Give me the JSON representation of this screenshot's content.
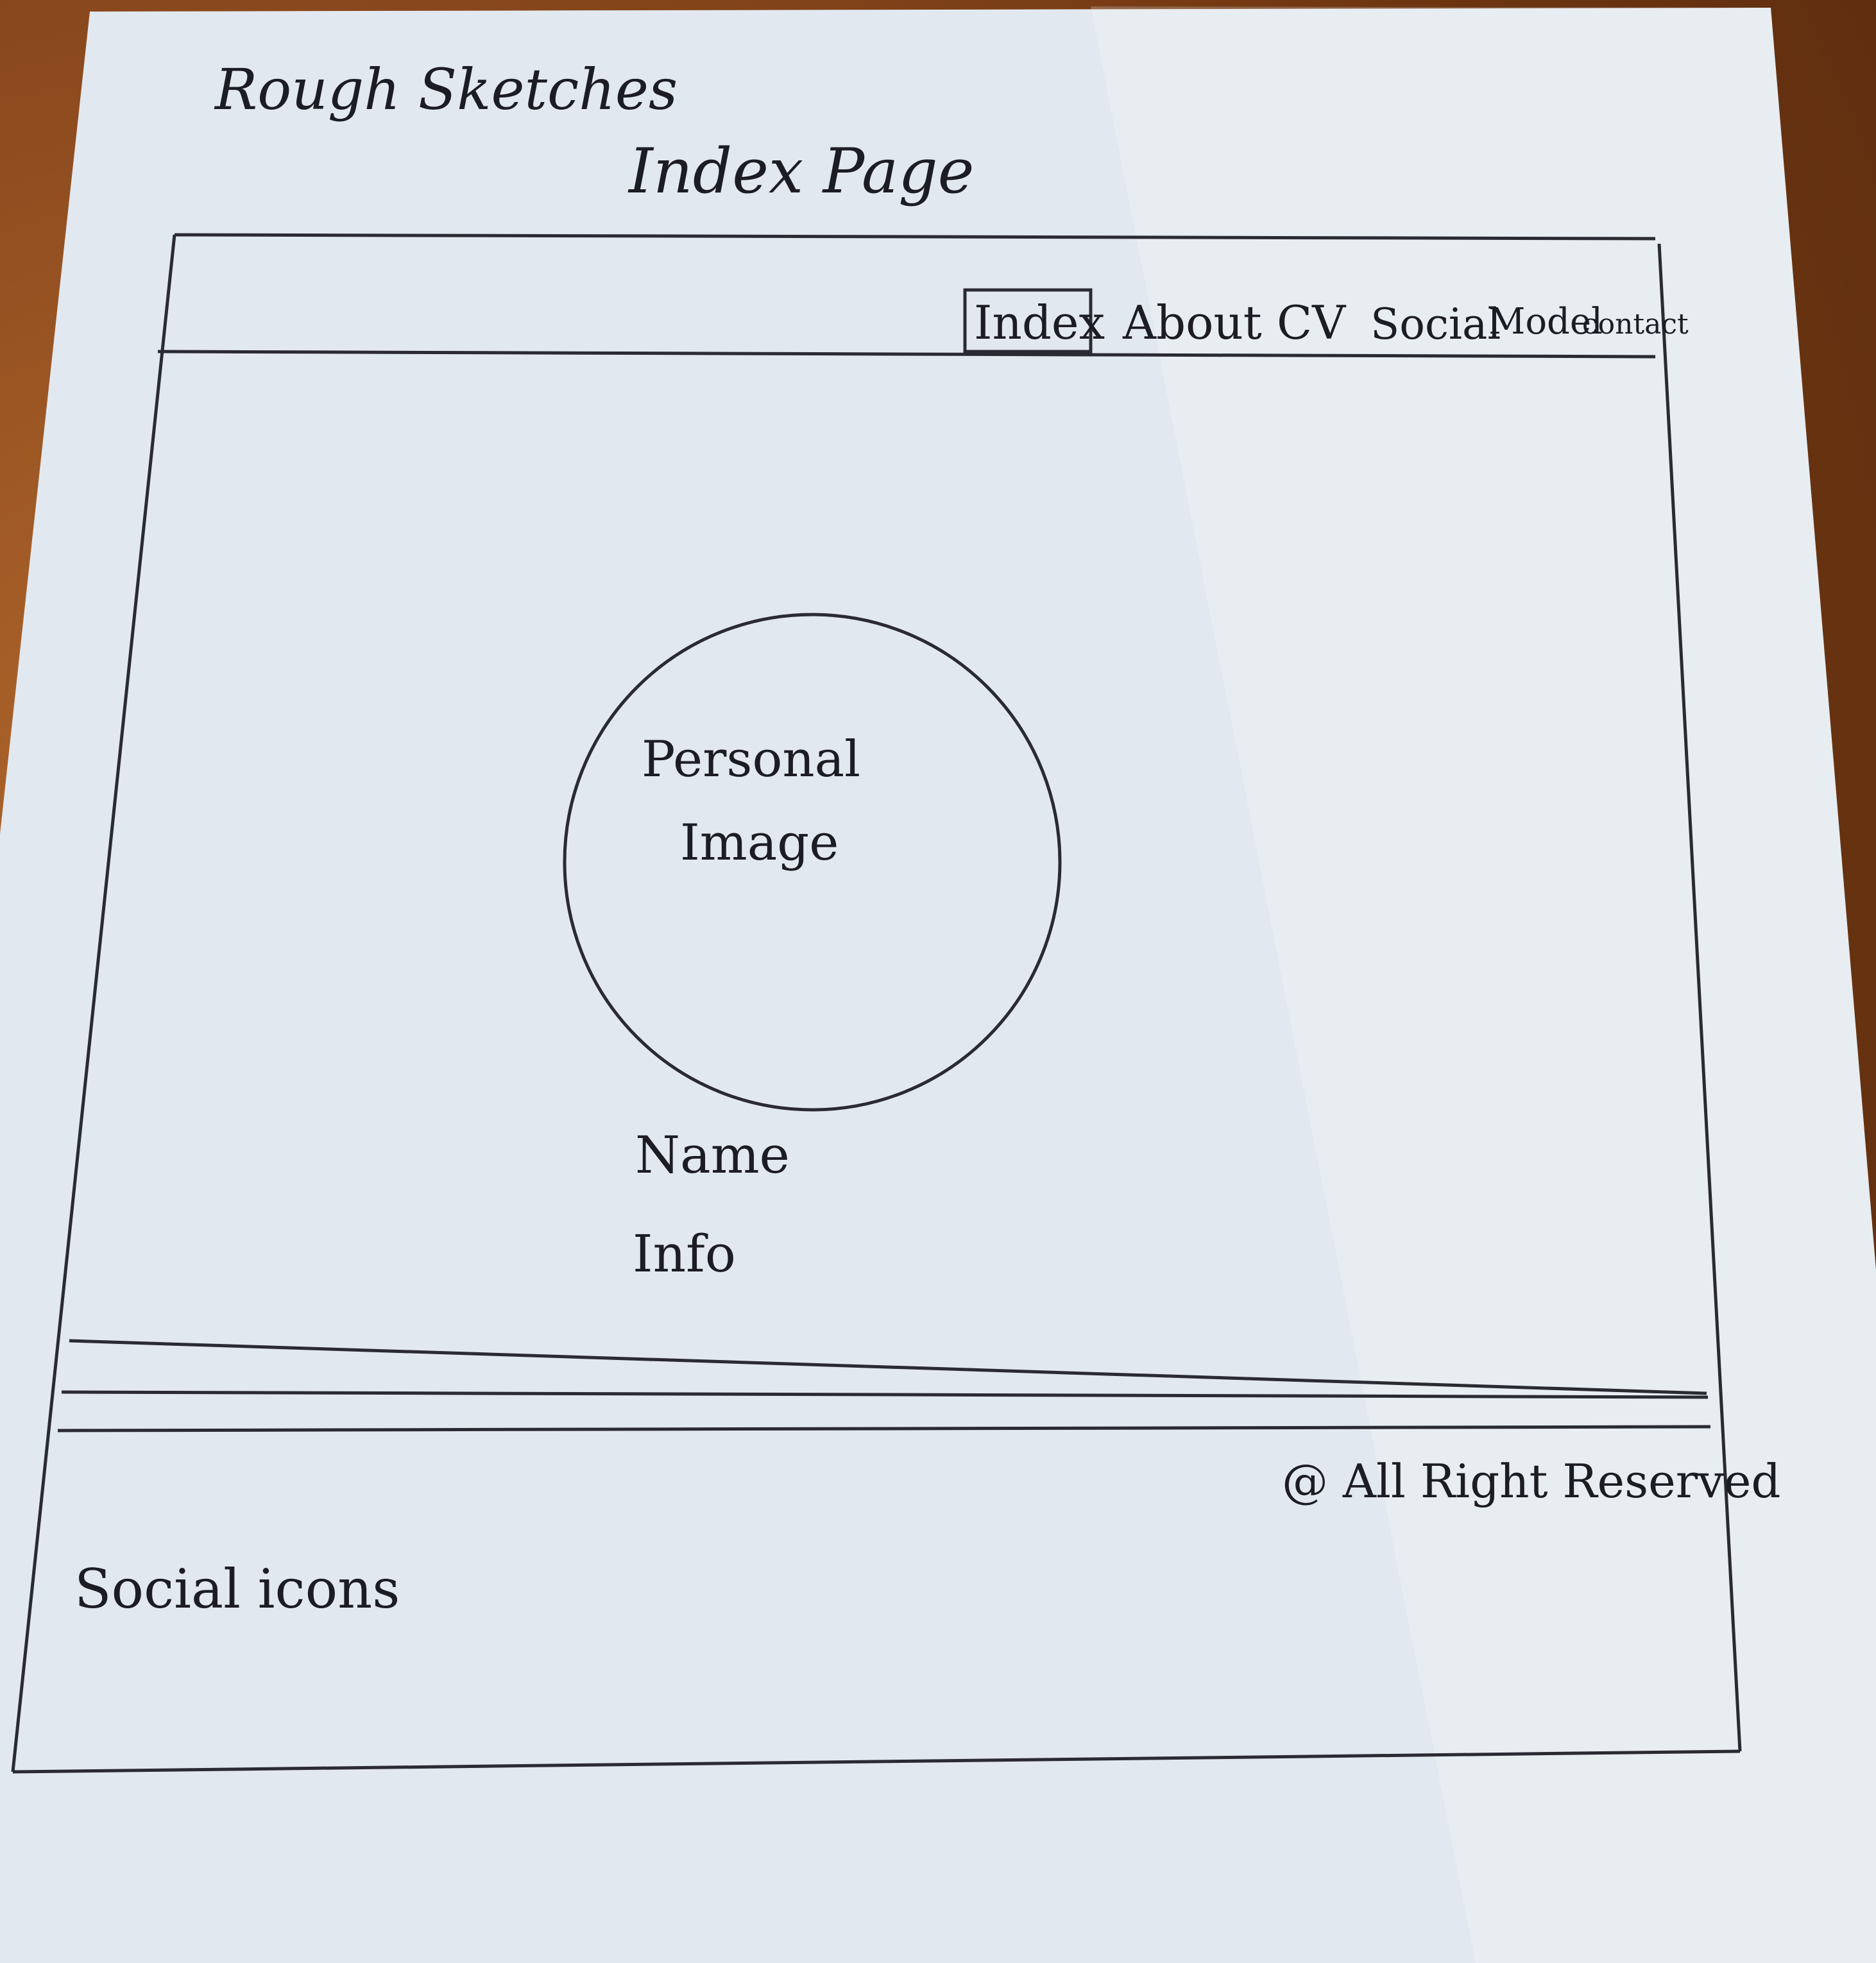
{
  "sketch": {
    "heading": "Rough Sketches",
    "page_title": "Index Page"
  },
  "header": {
    "nav": [
      {
        "label": "Index",
        "active": true
      },
      {
        "label": "About",
        "active": false
      },
      {
        "label": "CV",
        "active": false
      },
      {
        "label": "Social",
        "active": false
      },
      {
        "label": "Model",
        "active": false
      },
      {
        "label": "contact",
        "active": false
      }
    ]
  },
  "main": {
    "image_label_line1": "Personal",
    "image_label_line2": "Image",
    "name_label": "Name",
    "info_label": "Info"
  },
  "footer": {
    "social_label": "Social icons",
    "copyright": "@  All Right Reserved"
  },
  "colors": {
    "paper": "#e2e8ef",
    "ink": "#1c1c24",
    "table": "#7a3d17"
  }
}
